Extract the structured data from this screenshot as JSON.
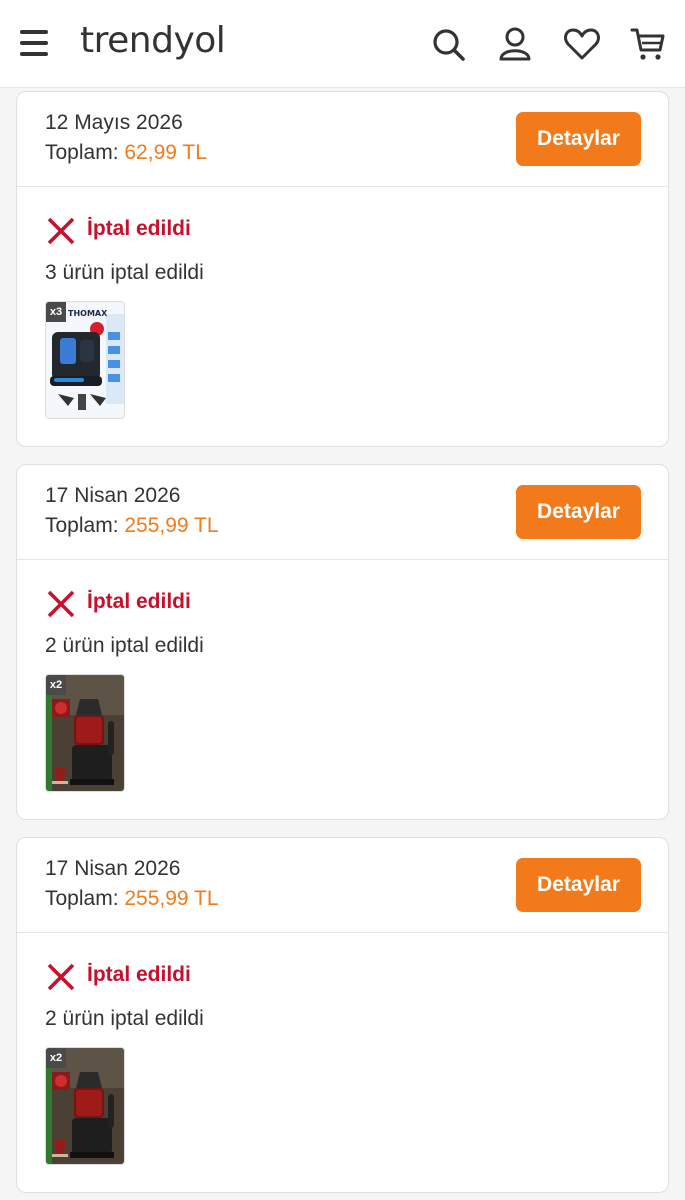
{
  "header": {
    "logo": "trendyol",
    "icons": [
      "menu-icon",
      "search-icon",
      "user-icon",
      "heart-icon",
      "cart-icon"
    ]
  },
  "orders": [
    {
      "date": "12 Mayıs 2026",
      "total_label": "Toplam:",
      "total_amount": "62,99 TL",
      "button_label": "Detaylar",
      "status": "İptal edildi",
      "count_text": "3 ürün iptal edildi",
      "product_qty": "x3",
      "product_brand": "THOMAX"
    },
    {
      "date": "17 Nisan 2026",
      "total_label": "Toplam:",
      "total_amount": "255,99 TL",
      "button_label": "Detaylar",
      "status": "İptal edildi",
      "count_text": "2 ürün iptal edildi",
      "product_qty": "x2"
    },
    {
      "date": "17 Nisan 2026",
      "total_label": "Toplam:",
      "total_amount": "255,99 TL",
      "button_label": "Detaylar",
      "status": "İptal edildi",
      "count_text": "2 ürün iptal edildi",
      "product_qty": "x2"
    }
  ],
  "colors": {
    "accent": "#f27a1a",
    "cancelled": "#c8102e"
  }
}
